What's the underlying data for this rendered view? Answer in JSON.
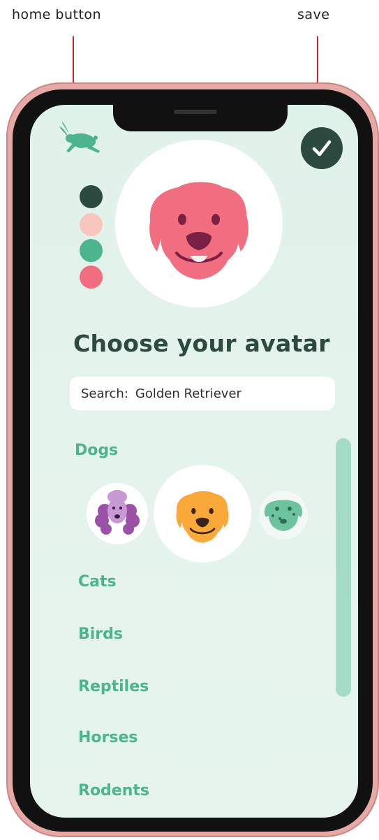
{
  "annotations": {
    "home_label": "home button",
    "save_label": "save"
  },
  "colors": {
    "swatches": [
      "#2d4a40",
      "#f8c5bf",
      "#4db58e",
      "#f06e80"
    ],
    "selected_avatar": "#f06e80",
    "accent": "#4db58e",
    "scrollbar": "#a5dcc6"
  },
  "avatar": {
    "icon": "golden-retriever-icon"
  },
  "screen": {
    "title": "Choose your avatar",
    "search": {
      "label": "Search:",
      "value": "Golden Retriever"
    },
    "categories": [
      "Dogs",
      "Cats",
      "Birds",
      "Reptiles",
      "Horses",
      "Rodents"
    ],
    "dog_breeds": [
      "poodle-icon",
      "golden-retriever-icon",
      "dalmatian-icon"
    ]
  }
}
